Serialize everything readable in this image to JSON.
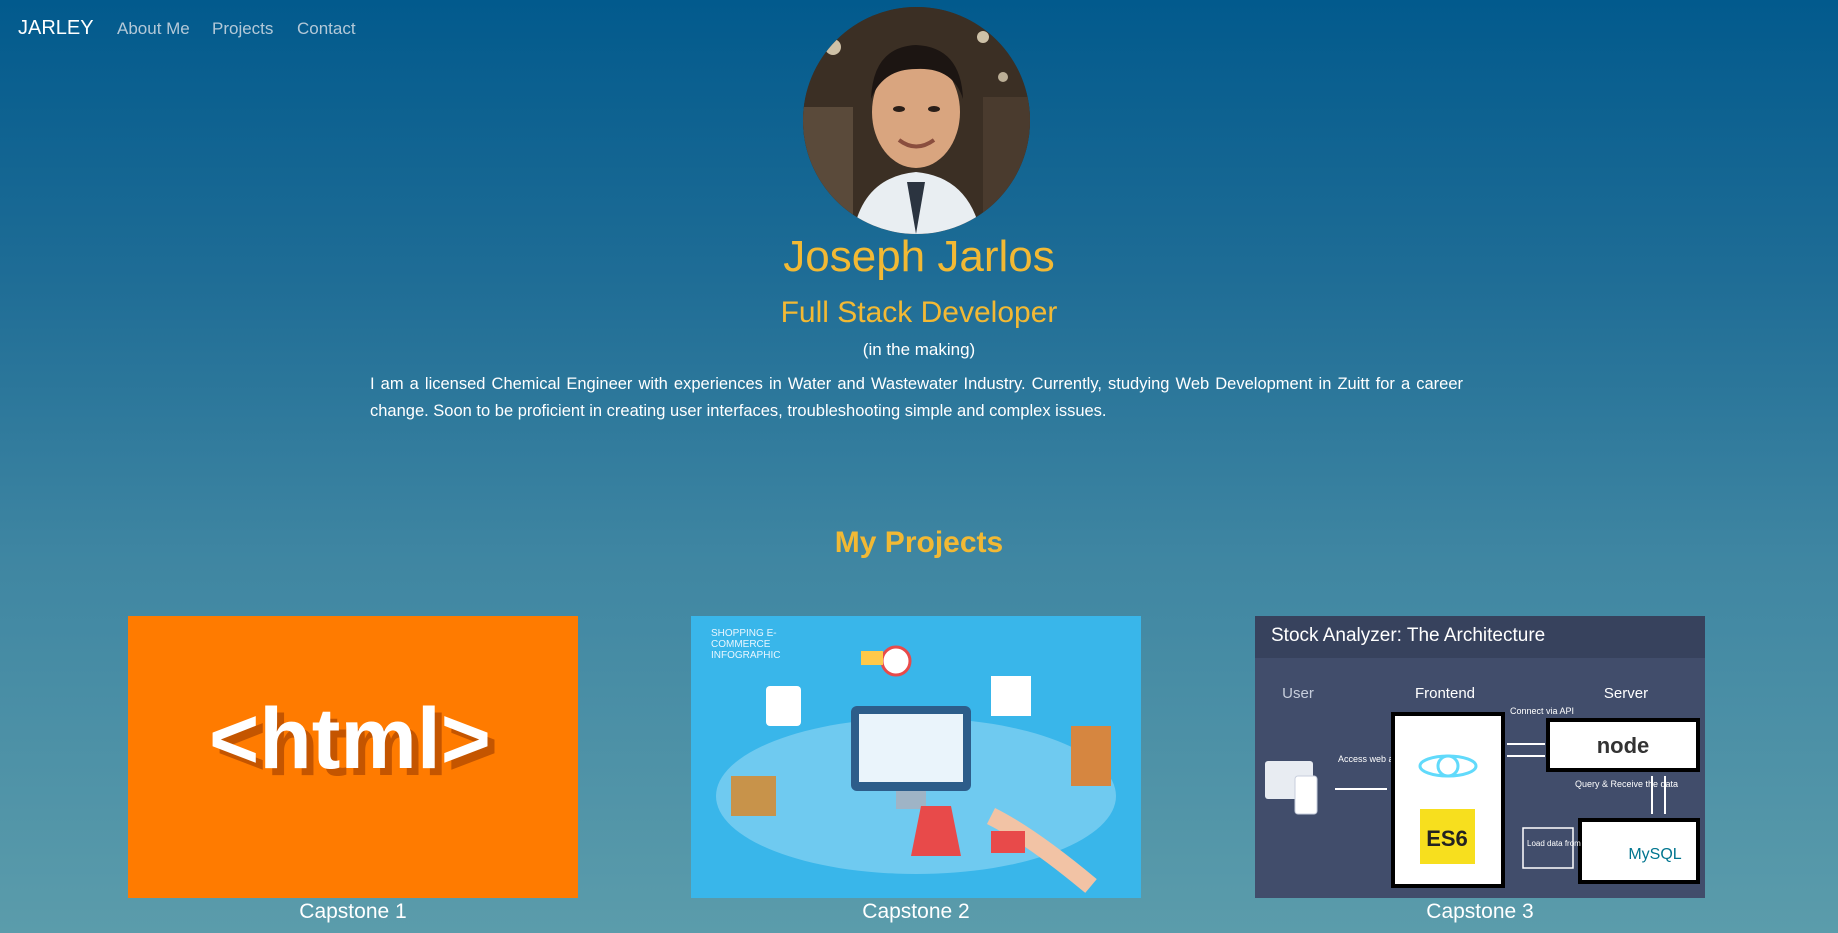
{
  "nav": {
    "brand": "JARLEY",
    "links": [
      "About Me",
      "Projects",
      "Contact"
    ]
  },
  "hero": {
    "name": "Joseph Jarlos",
    "role": "Full Stack Developer",
    "subtitle": "(in the making)",
    "bio": "I am a licensed Chemical Engineer with experiences in Water and Wastewater Industry. Currently, studying Web Development in Zuitt for a career change. Soon to be proficient in creating user interfaces, troubleshooting simple and complex issues."
  },
  "projects": {
    "title": "My Projects",
    "items": [
      {
        "label": "Capstone 1",
        "thumb_text": "<html>"
      },
      {
        "label": "Capstone 2",
        "thumb_text": "SHOPPING E-COMMERCE INFOGRAPHIC"
      },
      {
        "label": "Capstone 3",
        "thumb_text": "Stock Analyzer: The Architecture"
      }
    ]
  },
  "capstone3_diagram": {
    "columns": [
      "User",
      "Frontend",
      "Server"
    ],
    "notes": [
      "Access web app",
      "Connect via API",
      "Query & Receive the data",
      "Load data from file"
    ],
    "tech": [
      "ES6",
      "node",
      "MySQL"
    ]
  },
  "colors": {
    "accent": "#f2b934",
    "bg_top": "#025a8d",
    "bg_bottom": "#5b9cab",
    "html_orange": "#ff7b00",
    "shop_blue": "#39b6ea"
  }
}
